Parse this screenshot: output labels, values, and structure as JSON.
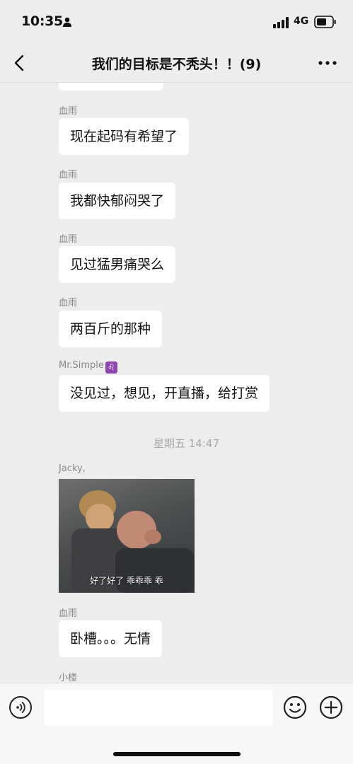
{
  "status_bar": {
    "time": "10:35",
    "network": "4G"
  },
  "header": {
    "title": "我们的目标是不秃头！！(9)"
  },
  "messages": [
    {
      "sender": "血雨",
      "text": "现在起码有希望了"
    },
    {
      "sender": "血雨",
      "text": "我都快郁闷哭了"
    },
    {
      "sender": "血雨",
      "text": "见过猛男痛哭么"
    },
    {
      "sender": "血雨",
      "text": "两百斤的那种"
    },
    {
      "sender": "Mr.Simple",
      "sender_badge": "♌",
      "text": "没见过，想见，开直播，给打赏"
    }
  ],
  "timestamp": "星期五 14:47",
  "gif_message": {
    "sender": "Jacky,",
    "caption": "好了好了 乖乖乖 乖"
  },
  "after_messages": [
    {
      "sender": "血雨",
      "text": "卧槽。。。无情"
    }
  ],
  "last_sender": "小楼",
  "input": {
    "value": "",
    "placeholder": ""
  },
  "colors": {
    "chat_background": "#ededed",
    "bubble": "#ffffff",
    "badge": "#8e44ad"
  }
}
